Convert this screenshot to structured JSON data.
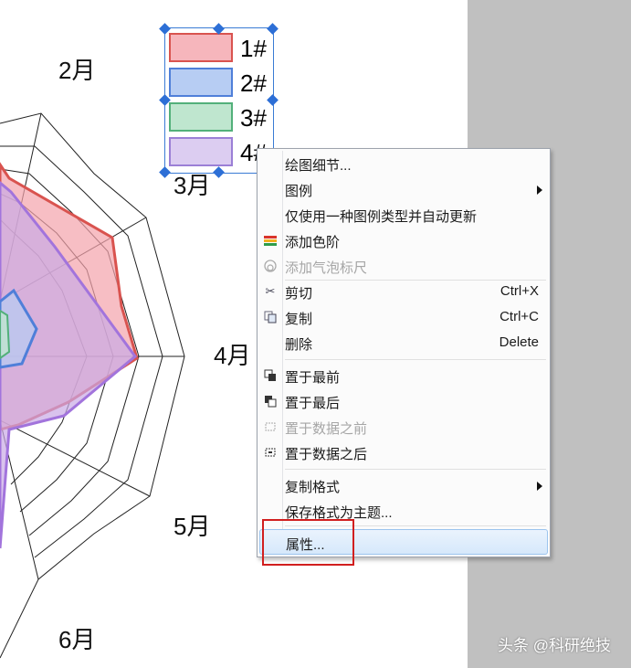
{
  "chart": {
    "months": [
      "2月",
      "3月",
      "4月",
      "5月",
      "6月"
    ],
    "legend": [
      {
        "label": "1#",
        "fill": "#f6b6bc",
        "border": "#d9534f"
      },
      {
        "label": "2#",
        "fill": "#b7cdf3",
        "border": "#4f7fd9"
      },
      {
        "label": "3#",
        "fill": "#bfe6cf",
        "border": "#52b07a"
      },
      {
        "label": "4#",
        "fill": "#dccdf1",
        "border": "#9b7fd6"
      }
    ]
  },
  "context_menu": {
    "items": [
      {
        "label": "绘图细节...",
        "icon": "",
        "shortcut": "",
        "submenu": false,
        "disabled": false
      },
      {
        "label": "图例",
        "icon": "",
        "shortcut": "",
        "submenu": true,
        "disabled": false
      },
      {
        "label": "仅使用一种图例类型并自动更新",
        "icon": "",
        "shortcut": "",
        "submenu": false,
        "disabled": false
      },
      {
        "label": "添加色阶",
        "icon": "color-scale-icon",
        "shortcut": "",
        "submenu": false,
        "disabled": false
      },
      {
        "label": "添加气泡标尺",
        "icon": "bubble-scale-icon",
        "shortcut": "",
        "submenu": false,
        "disabled": true
      },
      {
        "label": "剪切",
        "icon": "scissors-icon",
        "shortcut": "Ctrl+X",
        "submenu": false,
        "disabled": false
      },
      {
        "label": "复制",
        "icon": "copy-icon",
        "shortcut": "Ctrl+C",
        "submenu": false,
        "disabled": false
      },
      {
        "label": "删除",
        "icon": "",
        "shortcut": "Delete",
        "submenu": false,
        "disabled": false
      },
      {
        "label": "置于最前",
        "icon": "bring-front-icon",
        "shortcut": "",
        "submenu": false,
        "disabled": false
      },
      {
        "label": "置于最后",
        "icon": "send-back-icon",
        "shortcut": "",
        "submenu": false,
        "disabled": false
      },
      {
        "label": "置于数据之前",
        "icon": "before-data-icon",
        "shortcut": "",
        "submenu": false,
        "disabled": true
      },
      {
        "label": "置于数据之后",
        "icon": "after-data-icon",
        "shortcut": "",
        "submenu": false,
        "disabled": false
      },
      {
        "label": "复制格式",
        "icon": "",
        "shortcut": "",
        "submenu": true,
        "disabled": false
      },
      {
        "label": "保存格式为主题...",
        "icon": "",
        "shortcut": "",
        "submenu": false,
        "disabled": false
      },
      {
        "label": "属性...",
        "icon": "",
        "shortcut": "",
        "submenu": false,
        "disabled": false,
        "highlighted": true
      }
    ]
  },
  "watermark": "头条 @科研绝技"
}
